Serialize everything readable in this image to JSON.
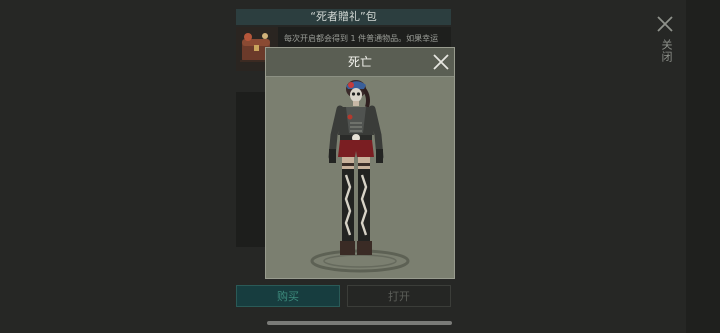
{
  "pack": {
    "title": "“死者贈礼”包",
    "description": "每次开启都会得到 1 件普通物品。如果幸运"
  },
  "modal": {
    "title": "死亡"
  },
  "buttons": {
    "buy": "购买",
    "open": "打开"
  },
  "side": {
    "close_label": "关闭"
  },
  "icons": [
    "close-icon",
    "chest-icon"
  ],
  "colors": {
    "background": "#262725",
    "modal": "#7b7f70",
    "modal_header": "#5a5e53",
    "buy_button": "#173d3f",
    "buy_text": "#3c8a7c",
    "title_bar": "#2c3e3f"
  }
}
